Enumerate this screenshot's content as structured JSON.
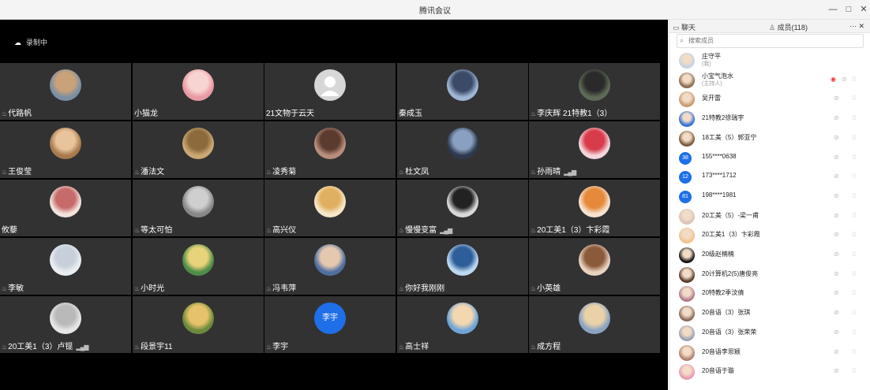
{
  "window": {
    "title": "腾讯会议",
    "controls": [
      "—",
      "□",
      "✕"
    ]
  },
  "recording": {
    "icon": "cloud-icon",
    "label": "录制中"
  },
  "tiles": [
    {
      "name": "代路帆",
      "mic": true,
      "signal": false,
      "avatar": {
        "bg": "#7b8fa3",
        "fg": "#c9a27a"
      }
    },
    {
      "name": "小猫龙",
      "mic": false,
      "signal": false,
      "avatar": {
        "bg": "#e99aa3",
        "fg": "#f7d4d2"
      }
    },
    {
      "name": "21文物于云天",
      "mic": false,
      "signal": false,
      "avatar": {
        "bg": "#d7d7d7",
        "fg": "#ffffff",
        "default": true
      }
    },
    {
      "name": "秦成玉",
      "mic": false,
      "signal": false,
      "avatar": {
        "bg": "#9fb6d4",
        "fg": "#3b4a66"
      }
    },
    {
      "name": "李庆辉 21特教1（3）",
      "mic": true,
      "signal": false,
      "avatar": {
        "bg": "#5e6a55",
        "fg": "#2a2a2a"
      }
    },
    {
      "name": "王俊莹",
      "mic": true,
      "signal": false,
      "avatar": {
        "bg": "#a77a4e",
        "fg": "#e8c39b"
      }
    },
    {
      "name": "潘法文",
      "mic": true,
      "signal": false,
      "avatar": {
        "bg": "#c9a874",
        "fg": "#8d6a3c"
      }
    },
    {
      "name": "凌秀菊",
      "mic": true,
      "signal": false,
      "avatar": {
        "bg": "#b98e7d",
        "fg": "#5a3b2e"
      }
    },
    {
      "name": "杜文凤",
      "mic": true,
      "signal": false,
      "avatar": {
        "bg": "#2d3a4d",
        "fg": "#8aa0c0"
      }
    },
    {
      "name": "孙雨晴",
      "mic": true,
      "signal": true,
      "avatar": {
        "bg": "#f3d6dc",
        "fg": "#d83b4a"
      }
    },
    {
      "name": "攸藜",
      "mic": false,
      "signal": false,
      "avatar": {
        "bg": "#f1e2dc",
        "fg": "#c76a6a"
      }
    },
    {
      "name": "等太可怕",
      "mic": true,
      "signal": false,
      "avatar": {
        "bg": "#888888",
        "fg": "#cfcfcf"
      }
    },
    {
      "name": "高兴仪",
      "mic": true,
      "signal": false,
      "avatar": {
        "bg": "#f5e6c8",
        "fg": "#e0b060"
      }
    },
    {
      "name": "慢慢变富",
      "mic": true,
      "signal": true,
      "avatar": {
        "bg": "#d9d9d9",
        "fg": "#222222"
      }
    },
    {
      "name": "20工美1（3）卞彩霞",
      "mic": true,
      "signal": false,
      "avatar": {
        "bg": "#f6e3cf",
        "fg": "#e58a3a"
      }
    },
    {
      "name": "李敏",
      "mic": true,
      "signal": false,
      "avatar": {
        "bg": "#e9eef2",
        "fg": "#c7cfd8"
      }
    },
    {
      "name": "小时光",
      "mic": true,
      "signal": false,
      "avatar": {
        "bg": "#4e8c4a",
        "fg": "#e7d37a"
      }
    },
    {
      "name": "冯韦萍",
      "mic": true,
      "signal": false,
      "avatar": {
        "bg": "#4f6f9f",
        "fg": "#e4c8b0"
      }
    },
    {
      "name": "你好我刚刚",
      "mic": true,
      "signal": false,
      "avatar": {
        "bg": "#bcd7f0",
        "fg": "#2e5e9a"
      }
    },
    {
      "name": "小英雄",
      "mic": true,
      "signal": false,
      "avatar": {
        "bg": "#e8d2c0",
        "fg": "#8a5a3a"
      }
    },
    {
      "name": "20工美1（3）卢锟",
      "mic": true,
      "signal": true,
      "avatar": {
        "bg": "#e6e6e6",
        "fg": "#b9b9b9"
      }
    },
    {
      "name": "段景宇11",
      "mic": true,
      "signal": false,
      "avatar": {
        "bg": "#6c8a3c",
        "fg": "#e6c36a"
      }
    },
    {
      "name": "李宇",
      "mic": true,
      "signal": false,
      "avatar": {
        "bg": "#1f6fe8",
        "fg": "#ffffff",
        "text": "李宇"
      }
    },
    {
      "name": "高士祥",
      "mic": true,
      "signal": false,
      "avatar": {
        "bg": "#6ea5d8",
        "fg": "#f2d7b0"
      }
    },
    {
      "name": "成方程",
      "mic": true,
      "signal": false,
      "avatar": {
        "bg": "#8aa3c2",
        "fg": "#e9d2a8"
      }
    }
  ],
  "panel": {
    "chat_tab": "聊天",
    "members_tab": "成员(118)",
    "more": "··· ✕",
    "search_placeholder": "搜索成员",
    "members": [
      {
        "name": "庄守平",
        "sub": "(我)",
        "avatar": "#c8d3e0",
        "num": null,
        "icons": false
      },
      {
        "name": "小宝气泡水",
        "sub": "(主持人)",
        "avatar": "#8a6a4f",
        "num": null,
        "icons": true,
        "eye": true
      },
      {
        "name": "吴开雷",
        "sub": "",
        "avatar": "#c79a6e",
        "num": null,
        "icons": true
      },
      {
        "name": "21特教2徐瑞宇",
        "sub": "",
        "avatar": "#2f6fd8",
        "num": null,
        "icons": true
      },
      {
        "name": "18工美（5）郭亚宁",
        "sub": "",
        "avatar": "#7a5a3a",
        "num": null,
        "icons": true
      },
      {
        "name": "155****0638",
        "sub": "",
        "avatar": null,
        "num": "38",
        "icons": true
      },
      {
        "name": "173****1712",
        "sub": "",
        "avatar": null,
        "num": "12",
        "icons": true
      },
      {
        "name": "198****1981",
        "sub": "",
        "avatar": null,
        "num": "81",
        "icons": true
      },
      {
        "name": "20工美（5）-梁一甫",
        "sub": "",
        "avatar": "#d9c6b8",
        "num": null,
        "icons": true
      },
      {
        "name": "20工美1（3）卞彩霞",
        "sub": "",
        "avatar": "#f0c38a",
        "num": null,
        "icons": true
      },
      {
        "name": "20级赵楠楠",
        "sub": "",
        "avatar": "#111111",
        "num": null,
        "icons": true
      },
      {
        "name": "20计算机2(5)唐俊亮",
        "sub": "",
        "avatar": "#5a3a2a",
        "num": null,
        "icons": true
      },
      {
        "name": "20特教2季汶倩",
        "sub": "",
        "avatar": "#b07a8a",
        "num": null,
        "icons": true
      },
      {
        "name": "20音语（3）张琪",
        "sub": "",
        "avatar": "#8a6a5a",
        "num": null,
        "icons": true
      },
      {
        "name": "20音语（3）张荣荣",
        "sub": "",
        "avatar": "#9aa3b0",
        "num": null,
        "icons": true
      },
      {
        "name": "20音语李思颖",
        "sub": "",
        "avatar": "#b08070",
        "num": null,
        "icons": true
      },
      {
        "name": "20音语于璇",
        "sub": "",
        "avatar": "#e79ab0",
        "num": null,
        "icons": true
      }
    ]
  }
}
